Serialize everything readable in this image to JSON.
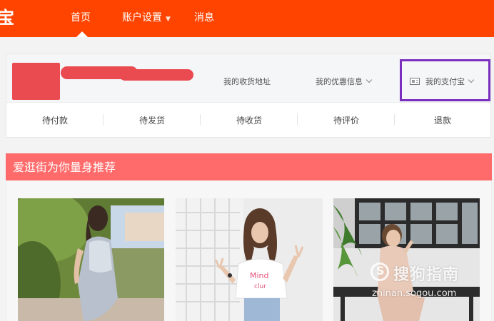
{
  "brand": {
    "logo_glyph": "宝",
    "color": "#ff4400"
  },
  "nav": {
    "home": "首页",
    "account": "账户设置",
    "messages": "消息"
  },
  "profile": {
    "links": {
      "address": "我的收货地址",
      "coupons": "我的优惠信息",
      "alipay": "我的支付宝"
    },
    "orders": [
      "待付款",
      "待发货",
      "待收货",
      "待评价",
      "退款"
    ],
    "redaction_color": "#e94b50",
    "highlight_color": "#7b2fbf"
  },
  "recommend": {
    "title": "爱逛街为你量身推荐",
    "header_color": "#ff6a6a"
  },
  "watermark": {
    "text": "搜狗指南",
    "url": "zhinan.sogou.com"
  }
}
